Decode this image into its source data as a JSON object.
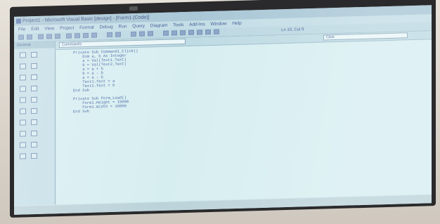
{
  "window": {
    "title": "Project1 - Microsoft Visual Basic [design] - [Form1 (Code)]"
  },
  "menubar": {
    "items": [
      "File",
      "Edit",
      "View",
      "Project",
      "Format",
      "Debug",
      "Run",
      "Query",
      "Diagram",
      "Tools",
      "Add-Ins",
      "Window",
      "Help"
    ]
  },
  "toolbar": {
    "position_label": "Ln 10, Col 9"
  },
  "toolbox": {
    "title": "General"
  },
  "code_window": {
    "object_combo": "Command1",
    "procedure_combo": "Click",
    "lines": [
      "Private Sub Command1_Click()",
      "    Dim a, b As Integer",
      "    a = Val(Text1.Text)",
      "    b = Val(Text2.Text)",
      "    a = a + b",
      "    b = a - b",
      "    a = a - b",
      "    Text1.Text = a",
      "    Text2.Text = b",
      "End Sub",
      "",
      "Private Sub Form_Load()",
      "    Form1.Height = 15000",
      "    Form1.Width = 16000",
      "End Sub"
    ]
  }
}
